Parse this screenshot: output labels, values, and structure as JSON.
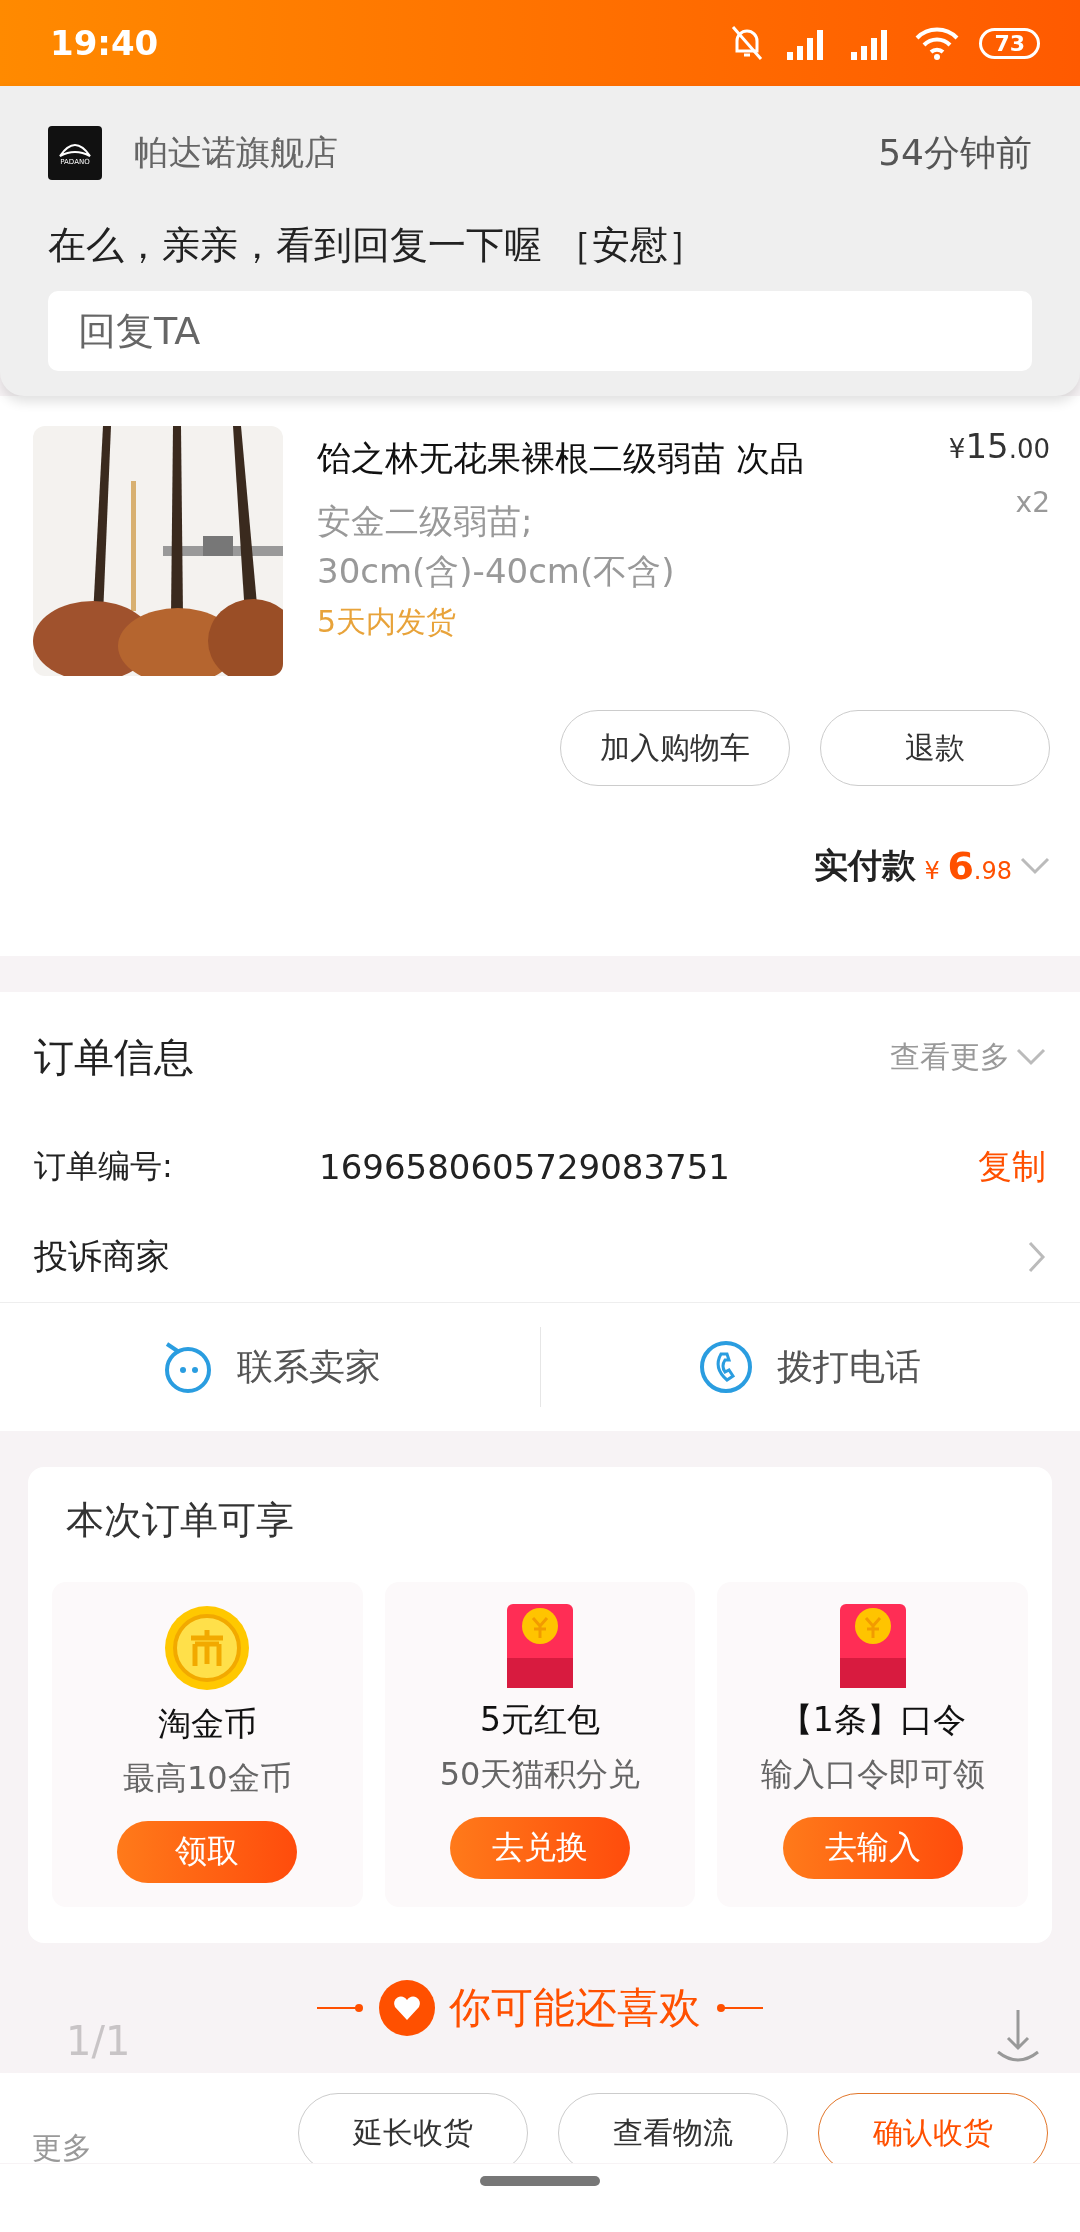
{
  "status_bar": {
    "time": "19:40",
    "battery": "73"
  },
  "notification": {
    "app_logo_text": "PADANO",
    "sender": "帕达诺旗舰店",
    "time": "54分钟前",
    "message": "在么，亲亲，看到回复一下喔 ［安慰］",
    "reply_field": {
      "placeholder": "回复TA"
    }
  },
  "product": {
    "kind": "picture",
    "title": "饴之林无花果裸根二级弱苗 次品",
    "price_symbol": "¥",
    "price_int": "15",
    "price_dec": ".00",
    "quantity": "x2",
    "spec_lines": [
      "安金二级弱苗;",
      "30cm(含)-40cm(不含)"
    ],
    "shipping": "5天内发货",
    "buttons": [
      "加入购物车",
      "退款"
    ]
  },
  "payment": {
    "label": "实付款",
    "symbol": "¥",
    "amount_int": "6",
    "amount_dec": ".98"
  },
  "order_info": {
    "title": "订单信息",
    "more": "查看更多",
    "rows": [
      {
        "kind": "copy",
        "label": "订单编号:",
        "value": "1696580605729083751",
        "action": "复制"
      },
      {
        "kind": "link",
        "label": "投诉商家"
      }
    ]
  },
  "contact": [
    {
      "kind": "chat",
      "label": "联系卖家"
    },
    {
      "kind": "phone",
      "label": "拨打电话"
    }
  ],
  "benefits": {
    "title": "本次订单可享",
    "items": [
      {
        "kind": "coin",
        "name": "淘金币",
        "desc": "最高10金币",
        "button": "领取"
      },
      {
        "kind": "packet",
        "name": "5元红包",
        "desc": "50天猫积分兑",
        "button": "去兑换"
      },
      {
        "kind": "packet",
        "name": "【1条】口令",
        "desc": "输入口令即可领",
        "button": "去输入"
      }
    ]
  },
  "recommend": {
    "title": "你可能还喜欢",
    "page": "1/1"
  },
  "bottom_bar": {
    "more": "更多",
    "buttons": [
      {
        "label": "延长收货",
        "primary": false
      },
      {
        "label": "查看物流",
        "primary": false
      },
      {
        "label": "确认收货",
        "primary": true
      }
    ]
  }
}
